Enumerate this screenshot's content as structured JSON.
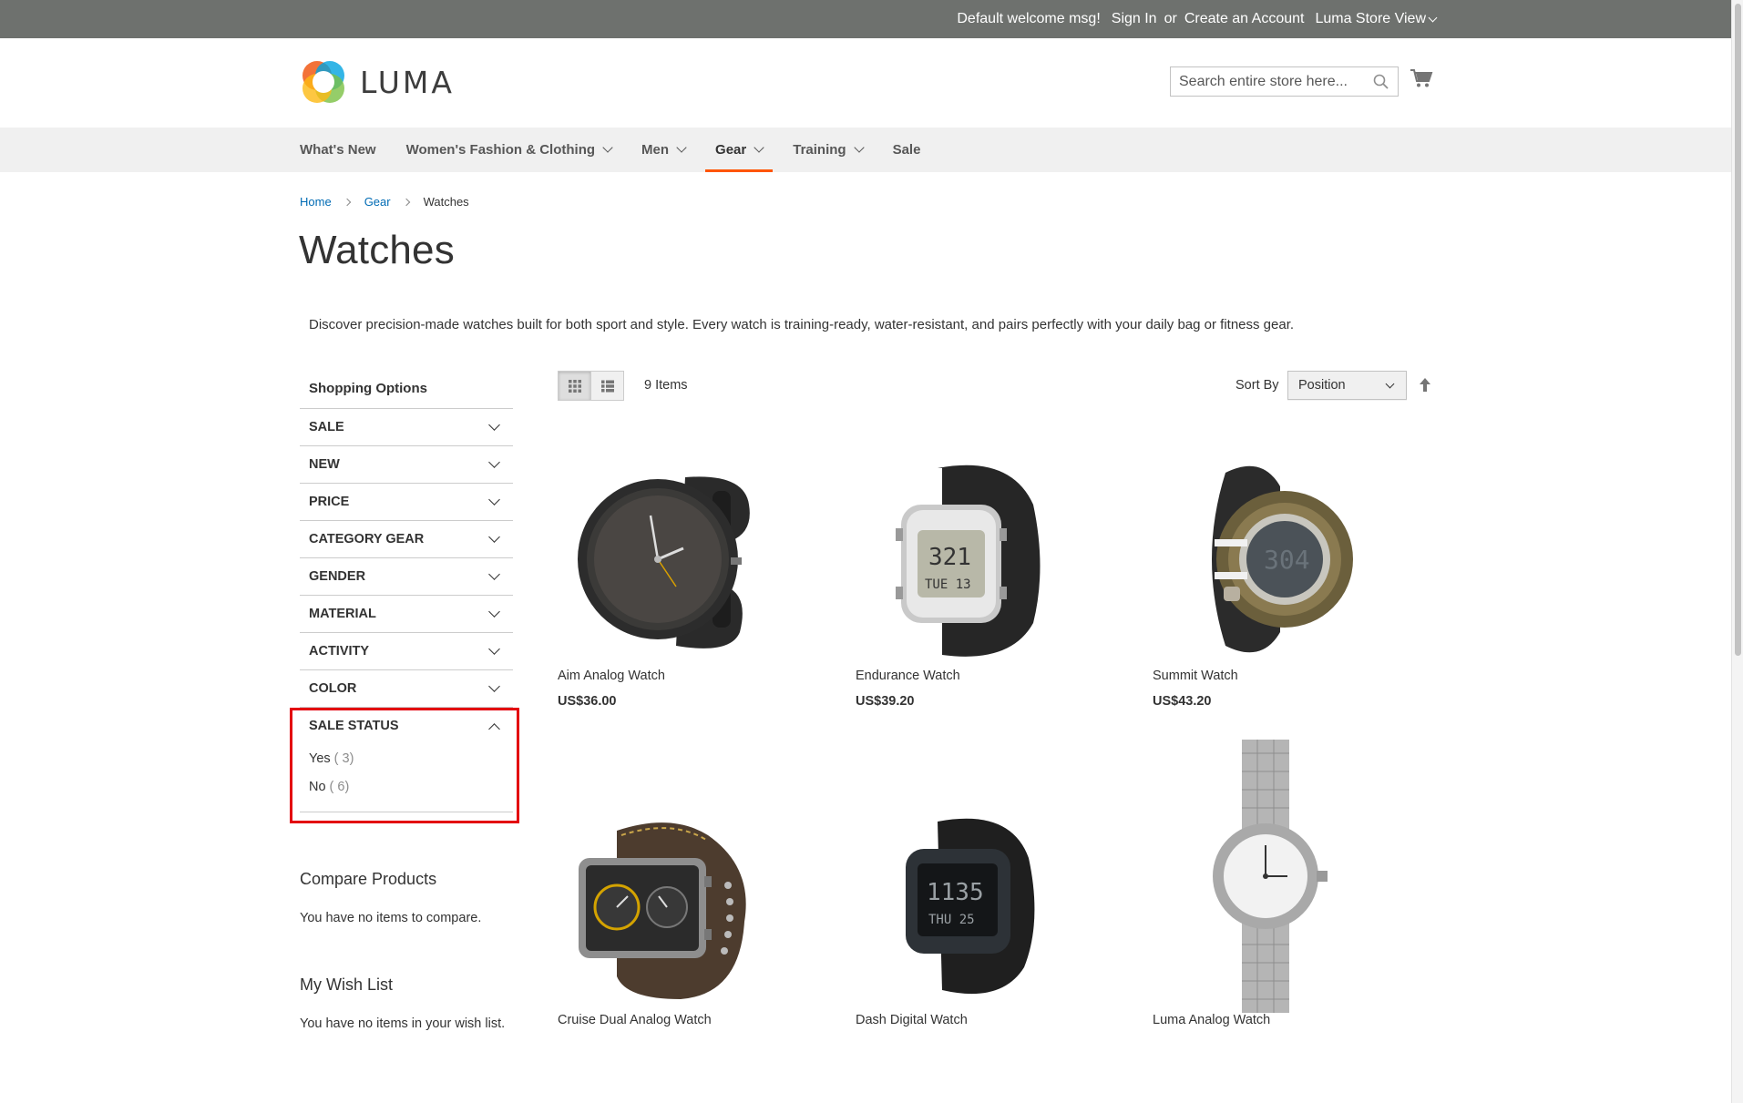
{
  "topbar": {
    "welcome": "Default welcome msg!",
    "sign_in": "Sign In",
    "or": "or",
    "create_account": "Create an Account",
    "store_view": "Luma Store View"
  },
  "header": {
    "logo_text": "LUMA",
    "search_placeholder": "Search entire store here..."
  },
  "nav": {
    "items": [
      {
        "label": "What's New"
      },
      {
        "label": "Women's Fashion & Clothing"
      },
      {
        "label": "Men"
      },
      {
        "label": "Gear"
      },
      {
        "label": "Training"
      },
      {
        "label": "Sale"
      }
    ]
  },
  "breadcrumb": {
    "home": "Home",
    "gear": "Gear",
    "current": "Watches"
  },
  "page": {
    "title": "Watches",
    "description": "Discover precision-made watches built for both sport and style. Every watch is training-ready, water-resistant, and pairs perfectly with your daily bag or fitness gear."
  },
  "sidebar": {
    "shopping_options": "Shopping Options",
    "filters": [
      {
        "label": "SALE"
      },
      {
        "label": "NEW"
      },
      {
        "label": "PRICE"
      },
      {
        "label": "CATEGORY GEAR"
      },
      {
        "label": "GENDER"
      },
      {
        "label": "MATERIAL"
      },
      {
        "label": "ACTIVITY"
      },
      {
        "label": "COLOR"
      },
      {
        "label": "SALE STATUS"
      }
    ],
    "sale_status_options": [
      {
        "label": "Yes",
        "count": "( 3)"
      },
      {
        "label": "No",
        "count": "( 6)"
      }
    ],
    "compare_title": "Compare Products",
    "compare_text": "You have no items to compare.",
    "wishlist_title": "My Wish List",
    "wishlist_text": "You have no items in your wish list."
  },
  "toolbar": {
    "items_count": "9 Items",
    "sort_label": "Sort By",
    "sort_value": "Position"
  },
  "products": [
    {
      "name": "Aim Analog Watch",
      "price": "US$36.00",
      "icon": "watch-analog-black"
    },
    {
      "name": "Endurance Watch",
      "price": "US$39.20",
      "icon": "watch-digital-silver"
    },
    {
      "name": "Summit Watch",
      "price": "US$43.20",
      "icon": "watch-digital-olive"
    },
    {
      "name": "Cruise Dual Analog Watch",
      "price": "",
      "icon": "watch-dual-brown"
    },
    {
      "name": "Dash Digital Watch",
      "price": "",
      "icon": "watch-digital-black"
    },
    {
      "name": "Luma Analog Watch",
      "price": "",
      "icon": "watch-metal-bracelet"
    }
  ],
  "colors": {
    "topbar_bg": "#6e716e",
    "nav_active": "#ff5501",
    "link": "#006bb4",
    "highlight": "#e3000f"
  }
}
